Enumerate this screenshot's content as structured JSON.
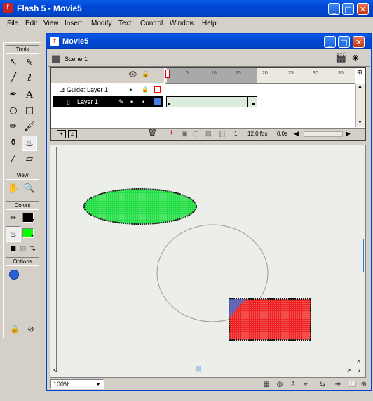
{
  "app": {
    "title": "Flash 5 - Movie5"
  },
  "window_controls": {
    "minimize": "_",
    "maximize": "□",
    "close": "✕"
  },
  "menu": [
    "File",
    "Edit",
    "View",
    "Insert",
    "Modify",
    "Text",
    "Control",
    "Window",
    "Help"
  ],
  "toolbox": {
    "tools_label": "Tools",
    "view_label": "View",
    "colors_label": "Colors",
    "options_label": "Options",
    "stroke_color": "#000000",
    "fill_color": "#00ff00"
  },
  "document": {
    "title": "Movie5",
    "scene_label": "Scene 1"
  },
  "timeline": {
    "ticks": [
      "5",
      "10",
      "15",
      "20",
      "25",
      "30",
      "35"
    ],
    "layers": [
      {
        "name": "Guide: Layer 1",
        "color": "#ff0000"
      },
      {
        "name": "Layer 1",
        "color": "#4a7ee8"
      }
    ],
    "current_frame": "1",
    "frame_rate": "12.0 fps",
    "elapsed": "0.0s"
  },
  "stage": {
    "ellipse_color": "#22dd44",
    "rect_color": "#ee2222"
  },
  "status": {
    "zoom": "100%"
  }
}
